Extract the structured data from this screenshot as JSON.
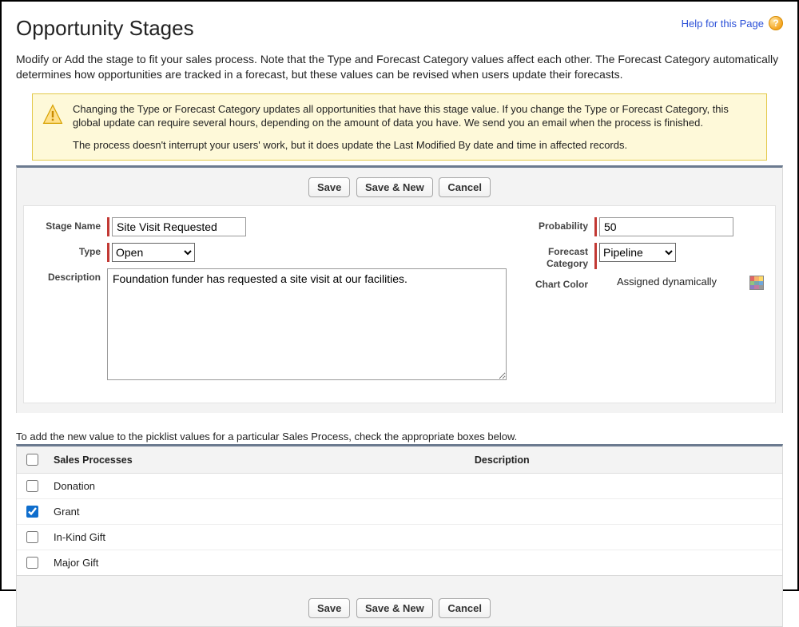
{
  "header": {
    "title": "Opportunity Stages",
    "help_label": "Help for this Page"
  },
  "intro": "Modify or Add the stage to fit your sales process. Note that the Type and Forecast Category values affect each other. The Forecast Category automatically determines how opportunities are tracked in a forecast, but these values can be revised when users update their forecasts.",
  "info": {
    "p1": "Changing the Type or Forecast Category updates all opportunities that have this stage value. If you change the Type or Forecast Category, this global update can require several hours, depending on the amount of data you have. We send you an email when the process is finished.",
    "p2": "The process doesn't interrupt your users' work, but it does update the Last Modified By date and time in affected records."
  },
  "buttons": {
    "save": "Save",
    "save_new": "Save & New",
    "cancel": "Cancel"
  },
  "form": {
    "stage_name_label": "Stage Name",
    "stage_name_value": "Site Visit Requested",
    "type_label": "Type",
    "type_value": "Open",
    "description_label": "Description",
    "description_value": "Foundation funder has requested a site visit at our facilities.",
    "probability_label": "Probability",
    "probability_value": "50",
    "forecast_label": "Forecast Category",
    "forecast_value": "Pipeline",
    "chart_color_label": "Chart Color",
    "chart_color_value": "Assigned dynamically"
  },
  "picklist": {
    "caption": "To add the new value to the picklist values for a particular Sales Process, check the appropriate boxes below.",
    "col_name": "Sales Processes",
    "col_desc": "Description",
    "rows": [
      {
        "name": "Donation",
        "checked": false,
        "desc": ""
      },
      {
        "name": "Grant",
        "checked": true,
        "desc": ""
      },
      {
        "name": "In-Kind Gift",
        "checked": false,
        "desc": ""
      },
      {
        "name": "Major Gift",
        "checked": false,
        "desc": ""
      }
    ]
  }
}
